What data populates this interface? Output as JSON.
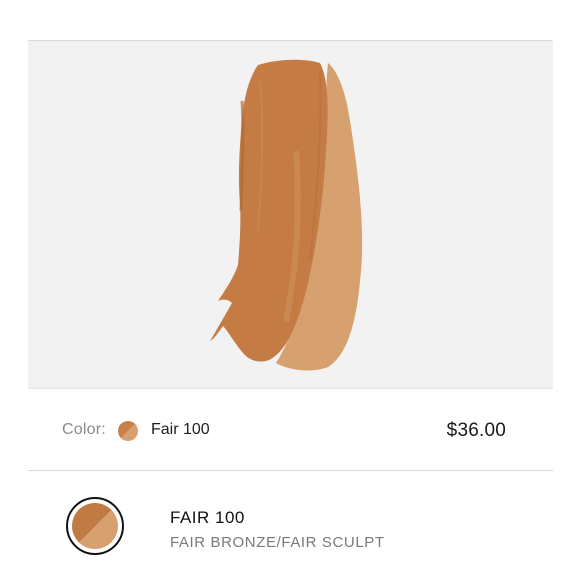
{
  "product": {
    "color_label": "Color:",
    "color_value": "Fair 100",
    "price": "$36.00"
  },
  "shade": {
    "name": "FAIR 100",
    "subtitle": "FAIR BRONZE/FAIR SCULPT"
  },
  "colors": {
    "swatch_dark": "#c27a45",
    "swatch_light": "#d7a06e",
    "panel_bg": "#f2f2f2"
  }
}
